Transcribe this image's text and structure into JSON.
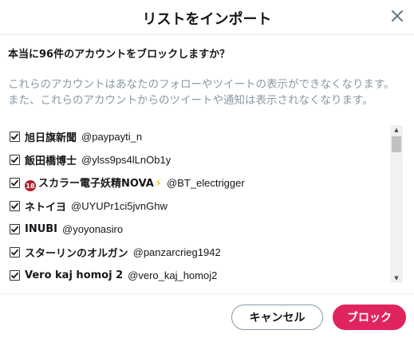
{
  "dialog": {
    "title": "リストをインポート",
    "question": "本当に96件のアカウントをブロックしますか？",
    "description": "これらのアカウントはあなたのフォローやツイートの表示ができなくなります。また、これらのアカウントからのツイートや通知は表示されなくなります。",
    "close_icon": "close-icon"
  },
  "accounts": [
    {
      "name": "旭日旗新聞",
      "handle": "@paypayti_n",
      "checked": true
    },
    {
      "name": "飯田橋博士",
      "handle": "@ylss9ps4lLnOb1y",
      "checked": true
    },
    {
      "badge": "18",
      "name": "スカラー電子妖精NOVA",
      "emoji": "⚡",
      "handle": "@BT_electrigger",
      "checked": true
    },
    {
      "name": "ネトイヨ",
      "handle": "@UYUPr1ci5jvnGhw",
      "checked": true
    },
    {
      "name": "INUBI",
      "handle": "@yoyonasiro",
      "checked": true
    },
    {
      "name": "スターリンのオルガン",
      "handle": "@panzarcrieg1942",
      "checked": true
    },
    {
      "name": "Vero kaj homoj 2",
      "handle": "@vero_kaj_homoj2",
      "checked": true
    }
  ],
  "footer": {
    "cancel_label": "キャンセル",
    "block_label": "ブロック"
  },
  "colors": {
    "accent": "#e0245e",
    "muted_text": "#8899a6",
    "text": "#14171a"
  }
}
